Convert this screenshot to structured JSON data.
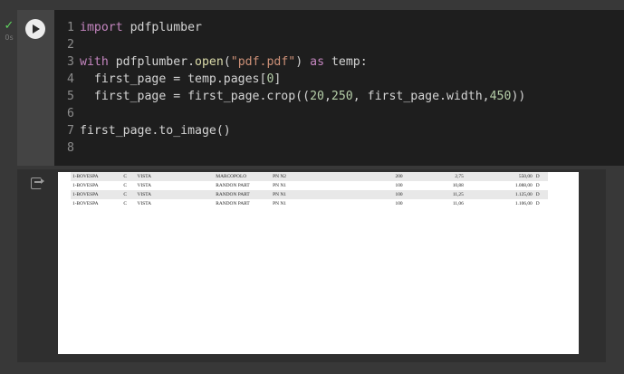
{
  "status": {
    "icon": "check-icon",
    "time": "0s"
  },
  "cell": {
    "run_icon": "play-icon",
    "lines": [
      {
        "n": "1",
        "tokens": [
          {
            "t": "import",
            "c": "kw"
          },
          {
            "t": " pdfplumber",
            "c": "code"
          }
        ]
      },
      {
        "n": "2",
        "tokens": []
      },
      {
        "n": "3",
        "tokens": [
          {
            "t": "with",
            "c": "kw"
          },
          {
            "t": " pdfplumber.",
            "c": "code"
          },
          {
            "t": "open",
            "c": "fn"
          },
          {
            "t": "(",
            "c": "code"
          },
          {
            "t": "\"pdf.pdf\"",
            "c": "str"
          },
          {
            "t": ") ",
            "c": "code"
          },
          {
            "t": "as",
            "c": "kw"
          },
          {
            "t": " temp:",
            "c": "code"
          }
        ]
      },
      {
        "n": "4",
        "tokens": [
          {
            "t": "  first_page = temp.pages[",
            "c": "code"
          },
          {
            "t": "0",
            "c": "num"
          },
          {
            "t": "]",
            "c": "code"
          }
        ]
      },
      {
        "n": "5",
        "tokens": [
          {
            "t": "  first_page = first_page.crop((",
            "c": "code"
          },
          {
            "t": "20",
            "c": "num"
          },
          {
            "t": ",",
            "c": "code"
          },
          {
            "t": "250",
            "c": "num"
          },
          {
            "t": ", first_page.width,",
            "c": "code"
          },
          {
            "t": "450",
            "c": "num"
          },
          {
            "t": "))",
            "c": "code"
          }
        ]
      },
      {
        "n": "6",
        "tokens": []
      },
      {
        "n": "7",
        "tokens": [
          {
            "t": "first_page.to_image()",
            "c": "code"
          }
        ]
      },
      {
        "n": "8",
        "tokens": []
      }
    ]
  },
  "output": {
    "icon": "output-redirect-icon",
    "rows": [
      {
        "shade": true,
        "cells": [
          "1-BOVESPA",
          "C",
          "VISTA",
          "MARCOPOLO",
          "PN N2",
          "",
          "200",
          "2,75",
          "550,00",
          "D"
        ]
      },
      {
        "shade": false,
        "cells": [
          "1-BOVESPA",
          "C",
          "VISTA",
          "RANDON PART",
          "PN N1",
          "",
          "100",
          "10,88",
          "1.088,00",
          "D"
        ]
      },
      {
        "shade": true,
        "cells": [
          "1-BOVESPA",
          "C",
          "VISTA",
          "RANDON PART",
          "PN N1",
          "",
          "100",
          "11,25",
          "1.125,00",
          "D"
        ]
      },
      {
        "shade": false,
        "cells": [
          "1-BOVESPA",
          "C",
          "VISTA",
          "RANDON PART",
          "PN N1",
          "",
          "100",
          "11,06",
          "1.106,00",
          "D"
        ]
      }
    ]
  }
}
